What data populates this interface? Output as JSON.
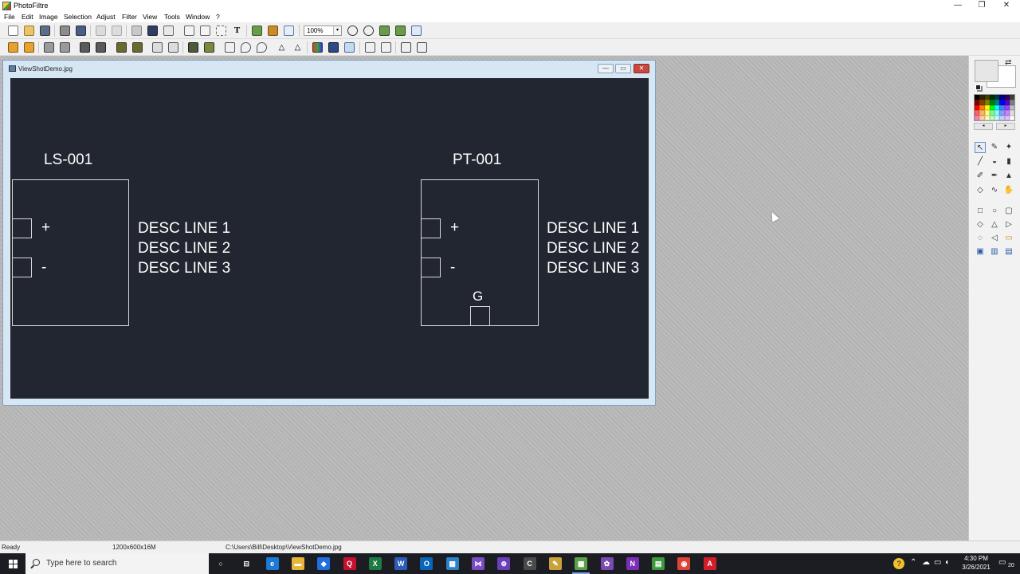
{
  "window": {
    "title": "PhotoFiltre",
    "controls": {
      "minimize": "—",
      "maximize": "❐",
      "close": "✕"
    }
  },
  "menu": [
    "File",
    "Edit",
    "Image",
    "Selection",
    "Adjust",
    "Filter",
    "View",
    "Tools",
    "Window",
    "?"
  ],
  "toolbar": {
    "zoom_value": "100%",
    "zoom_arrow": "▾"
  },
  "document": {
    "title": "ViewShotDemo.jpg",
    "controls": {
      "minimize": "—",
      "maximize": "▭",
      "close": "✕"
    },
    "drawing": {
      "left_device": {
        "tag": "LS-001",
        "plus": "+",
        "minus": "-",
        "desc": [
          "DESC LINE 1",
          "DESC LINE 2",
          "DESC LINE 3"
        ]
      },
      "right_device": {
        "tag": "PT-001",
        "plus": "+",
        "minus": "-",
        "ground": "G",
        "desc": [
          "DESC LINE 1",
          "DESC LINE 2",
          "DESC LINE 3"
        ]
      }
    }
  },
  "palette_colors": [
    "#000000",
    "#3a1e00",
    "#424200",
    "#003000",
    "#003a3a",
    "#000080",
    "#300060",
    "#404040",
    "#800000",
    "#804000",
    "#808000",
    "#008000",
    "#008080",
    "#0000ff",
    "#6000c0",
    "#808080",
    "#ff0000",
    "#ff8000",
    "#ffff00",
    "#00ff00",
    "#00ffff",
    "#4080ff",
    "#a040ff",
    "#c0c0c0",
    "#ff6060",
    "#ffb060",
    "#ffff80",
    "#80ff80",
    "#80ffff",
    "#80a0ff",
    "#d080ff",
    "#e0e0e0",
    "#ff80c0",
    "#ffd0a0",
    "#ffffc0",
    "#c0ffc0",
    "#c0ffff",
    "#c0d0ff",
    "#e0c0ff",
    "#ffffff"
  ],
  "palette_nav": {
    "prev": "◂",
    "next": "▸"
  },
  "tool_icons": {
    "swap": "⇄",
    "select": "↖",
    "picker": "✎",
    "wand": "✦",
    "line": "╱",
    "fill": "◒",
    "spray": "▮",
    "brush": "✐",
    "pen": "✒",
    "stamp": "▲",
    "drop": "◇",
    "smudge": "∿",
    "hand": "✋",
    "rect": "□",
    "ellipse": "○",
    "rounded": "▢",
    "diamond": "◇",
    "triangle": "△",
    "arrow": "▷",
    "lasso": "◌",
    "polygon": "◁",
    "folder": "▭",
    "tool-a": "▣",
    "tool-b": "▥",
    "tool-c": "▤"
  },
  "status": {
    "state": "Ready",
    "image_info": "1200x600x16M",
    "path": "C:\\Users\\Bill\\Desktop\\ViewShotDemo.jpg"
  },
  "taskbar": {
    "search_placeholder": "Type here to search",
    "apps": [
      {
        "icon": "○",
        "color": "transparent"
      },
      {
        "icon": "⊟",
        "color": "transparent"
      },
      {
        "icon": "e",
        "color": "#1c7ad6"
      },
      {
        "icon": "▬",
        "color": "#e8b43a"
      },
      {
        "icon": "◆",
        "color": "#1f6fe0"
      },
      {
        "icon": "Q",
        "color": "#c8102e"
      },
      {
        "icon": "X",
        "color": "#1d7a43"
      },
      {
        "icon": "W",
        "color": "#2b5cb8"
      },
      {
        "icon": "O",
        "color": "#0a64b8"
      },
      {
        "icon": "▦",
        "color": "#2a83c6"
      },
      {
        "icon": "⋈",
        "color": "#7b4bc4"
      },
      {
        "icon": "⊕",
        "color": "#6a3fb8"
      },
      {
        "icon": "C",
        "color": "#4a4a4a"
      },
      {
        "icon": "✎",
        "color": "#c9a33a"
      },
      {
        "icon": "▩",
        "color": "#5aa04a"
      },
      {
        "icon": "✿",
        "color": "#7a4ab0"
      },
      {
        "icon": "N",
        "color": "#7a2fb8"
      },
      {
        "icon": "▤",
        "color": "#3c9a3c"
      },
      {
        "icon": "◉",
        "color": "#db4437"
      },
      {
        "icon": "A",
        "color": "#d11f2a"
      }
    ],
    "tray_icons": [
      "?",
      "⌃",
      "☁",
      "▭",
      "◖",
      "🔇"
    ],
    "time": "4:30 PM",
    "date": "3/26/2021",
    "notification_icon": "▭",
    "notification_count": "20"
  }
}
